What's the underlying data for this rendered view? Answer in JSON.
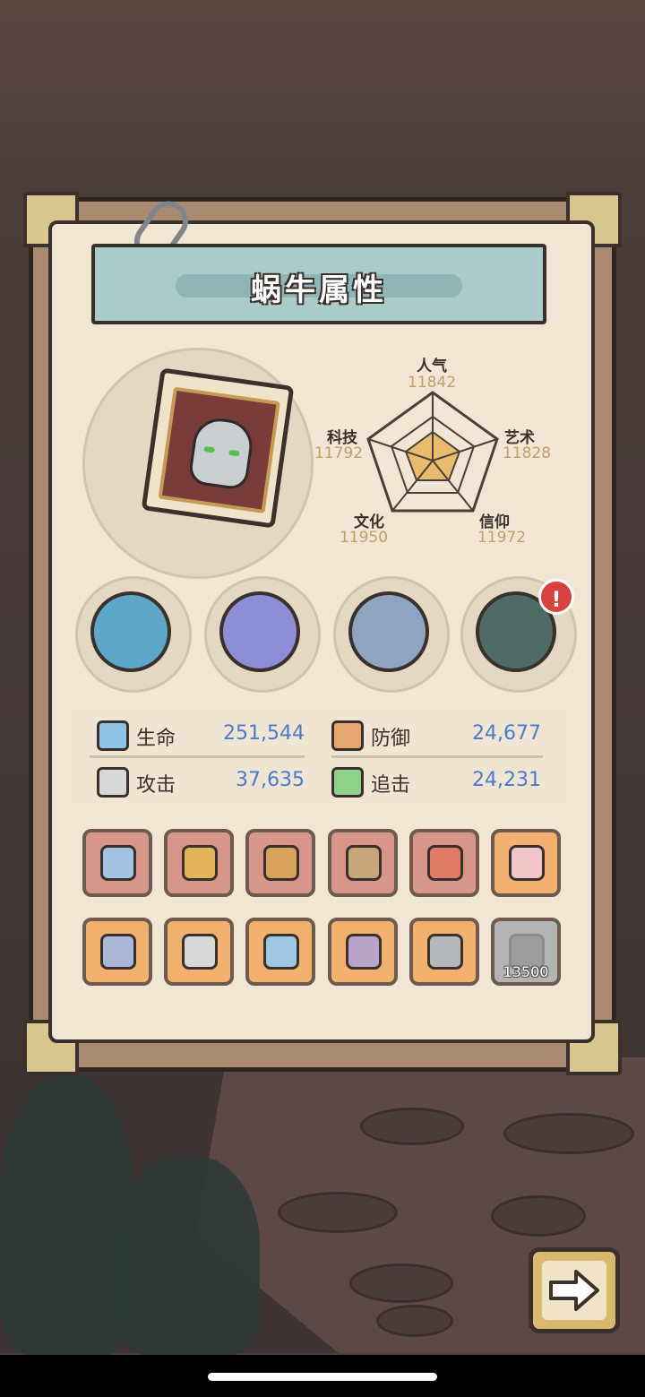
{
  "title": "蜗牛属性",
  "attributes": {
    "popularity": {
      "label": "人气",
      "value": "11842"
    },
    "art": {
      "label": "艺术",
      "value": "11828"
    },
    "faith": {
      "label": "信仰",
      "value": "11972"
    },
    "culture": {
      "label": "文化",
      "value": "11950"
    },
    "tech": {
      "label": "科技",
      "value": "11792"
    }
  },
  "stats": {
    "hp": {
      "label": "生命",
      "value": "251,544"
    },
    "defense": {
      "label": "防御",
      "value": "24,677"
    },
    "attack": {
      "label": "攻击",
      "value": "37,635"
    },
    "chase": {
      "label": "追击",
      "value": "24,231"
    }
  },
  "locked_slot_price": "13500",
  "badge_symbol": "!",
  "colors": {
    "board": "#a98b72",
    "paper": "#f1e6d3",
    "banner": "#a9ccca",
    "stat_value": "#4a7bd0",
    "attr_value": "#c2a06a",
    "slot_red": "#d8958a",
    "slot_orange": "#f2b16e"
  },
  "icons": {
    "equipment": [
      "fish-trophy-icon",
      "armor-icon",
      "compass-icon",
      "portal-icon"
    ],
    "gear_row1": [
      "sword-icon",
      "drum-icon",
      "crossbow-icon",
      "blaster-icon",
      "rocket-sword-icon",
      "vest-icon"
    ],
    "gear_row2": [
      "ring-icon",
      "dagger-icon",
      "bracelet-icon",
      "crown-icon",
      "belt-icon",
      "rose-icon"
    ]
  }
}
